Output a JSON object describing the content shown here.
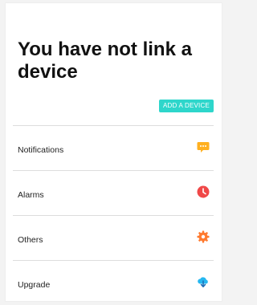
{
  "header": {
    "title": "You have not link a device"
  },
  "add_device": {
    "label": "ADD A DEVICE",
    "color": "#2ed6cb"
  },
  "menu": {
    "items": [
      {
        "label": "Notifications",
        "icon": "message-icon",
        "color": "#ffb020"
      },
      {
        "label": "Alarms",
        "icon": "clock-icon",
        "color": "#f04848"
      },
      {
        "label": "Others",
        "icon": "gear-icon",
        "color": "#ff7a2f"
      },
      {
        "label": "Upgrade",
        "icon": "cloud-download-icon",
        "color": "#25b7f0"
      }
    ]
  }
}
